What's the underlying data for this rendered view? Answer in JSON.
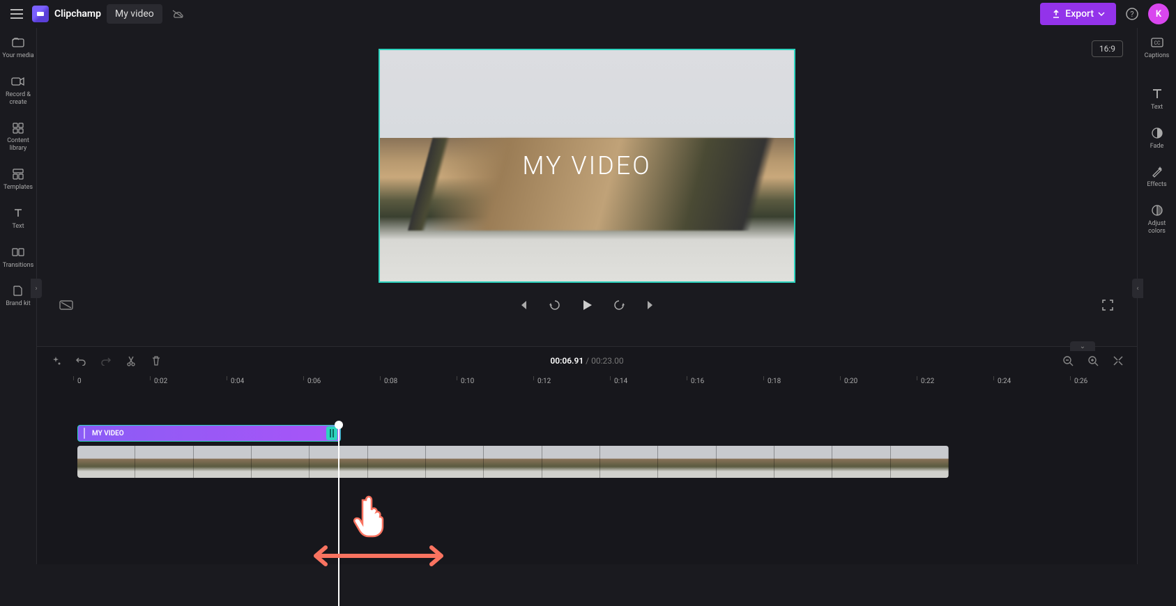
{
  "header": {
    "brand": "Clipchamp",
    "project_name": "My video",
    "export_label": "Export",
    "avatar_initial": "K"
  },
  "sidebar_left": {
    "items": [
      {
        "label": "Your media",
        "icon": "folder-icon"
      },
      {
        "label": "Record & create",
        "icon": "camera-icon"
      },
      {
        "label": "Content library",
        "icon": "library-icon"
      },
      {
        "label": "Templates",
        "icon": "templates-icon"
      },
      {
        "label": "Text",
        "icon": "text-icon"
      },
      {
        "label": "Transitions",
        "icon": "transitions-icon"
      },
      {
        "label": "Brand kit",
        "icon": "brandkit-icon"
      }
    ]
  },
  "sidebar_right": {
    "items": [
      {
        "label": "Captions",
        "icon": "captions-icon"
      },
      {
        "label": "Text",
        "icon": "text-big-icon"
      },
      {
        "label": "Fade",
        "icon": "fade-icon"
      },
      {
        "label": "Effects",
        "icon": "effects-icon"
      },
      {
        "label": "Adjust colors",
        "icon": "adjust-icon"
      }
    ]
  },
  "preview": {
    "aspect_ratio": "16:9",
    "overlay_text": "MY VIDEO"
  },
  "timeline": {
    "current_time": "00:06.91",
    "total_time": "00:23.00",
    "ticks": [
      "0",
      "0:02",
      "0:04",
      "0:06",
      "0:08",
      "0:10",
      "0:12",
      "0:14",
      "0:16",
      "0:18",
      "0:20",
      "0:22",
      "0:24",
      "0:26"
    ],
    "tick_spacing_px": 110,
    "text_clip_label": "MY VIDEO",
    "video_thumb_count": 15
  },
  "colors": {
    "accent_purple": "#9333ea",
    "track_purple": "#8b5cf6",
    "teal_border": "#2dd4bf",
    "annotation_orange": "#f97360"
  }
}
